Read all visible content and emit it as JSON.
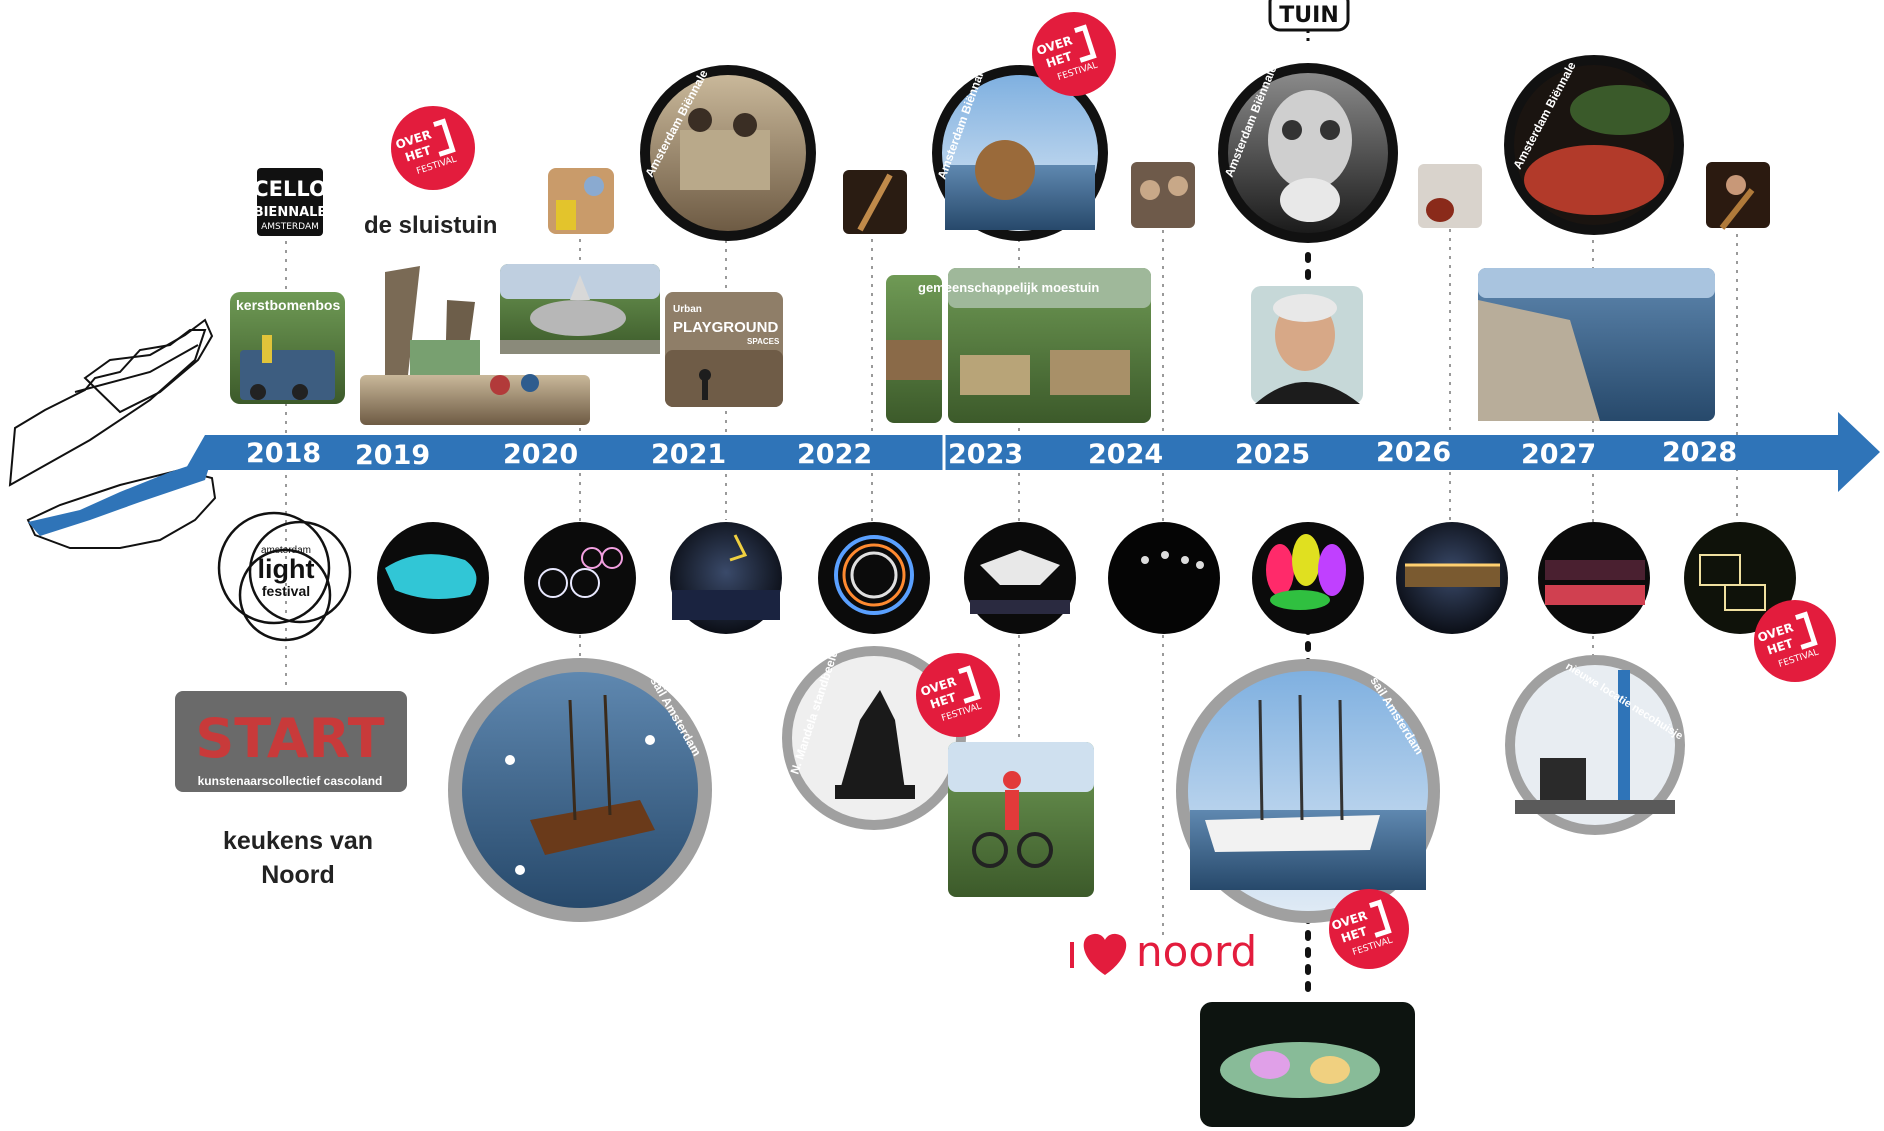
{
  "timeline": {
    "years": [
      "2018",
      "2019",
      "2020",
      "2021",
      "2022",
      "2023",
      "2024",
      "2025",
      "2026",
      "2027",
      "2028"
    ]
  },
  "colors": {
    "arrow": "#2f74b8",
    "festival_red": "#e31c3d",
    "dotted_line": "#9a9a9a",
    "ring_gray": "#a0a0a0",
    "ring_black": "#111111"
  },
  "labels": {
    "tuin": "TUIN",
    "de_sluistuin": "de sluistuin",
    "keukens_line1": "keukens van",
    "keukens_line2": "Noord",
    "noord": "noord"
  },
  "logos": {
    "cello_line1": "CELLO",
    "cello_line2": "BIENNALE",
    "cello_line3": "AMSTERDAM",
    "overhetij_line1": "OVER",
    "overhetij_line2": "HET",
    "overhetij_line3": "FESTIVAL",
    "alf_line1": "amsterdam",
    "alf_line2": "light",
    "alf_line3": "festival"
  },
  "photo_captions": {
    "kerstbomenbos": "kerstbomenbos",
    "playground_line1": "Urban",
    "playground_line2": "PLAYGROUND",
    "playground_line3": "SPACES",
    "moestuin": "gemeenschappelijk moestuin",
    "start": "START",
    "cascoland": "kunstenaarscollectief cascoland",
    "biennale_2021": "Amsterdam Biënnale",
    "biennale_2023": "Amsterdam Biënnale",
    "biennale_2025": "Amsterdam Biënnale",
    "biennale_2027": "Amsterdam Biënnale",
    "sail_2020": "sail Amsterdam",
    "sail_2025": "sail Amsterdam",
    "mandela": "N. Mandela standbeeld",
    "necohuisje": "nieuwe locatie necohuisje"
  },
  "icons": {
    "heart": "heart-icon",
    "arrow": "timeline-arrow",
    "map": "map-outline-icon"
  }
}
